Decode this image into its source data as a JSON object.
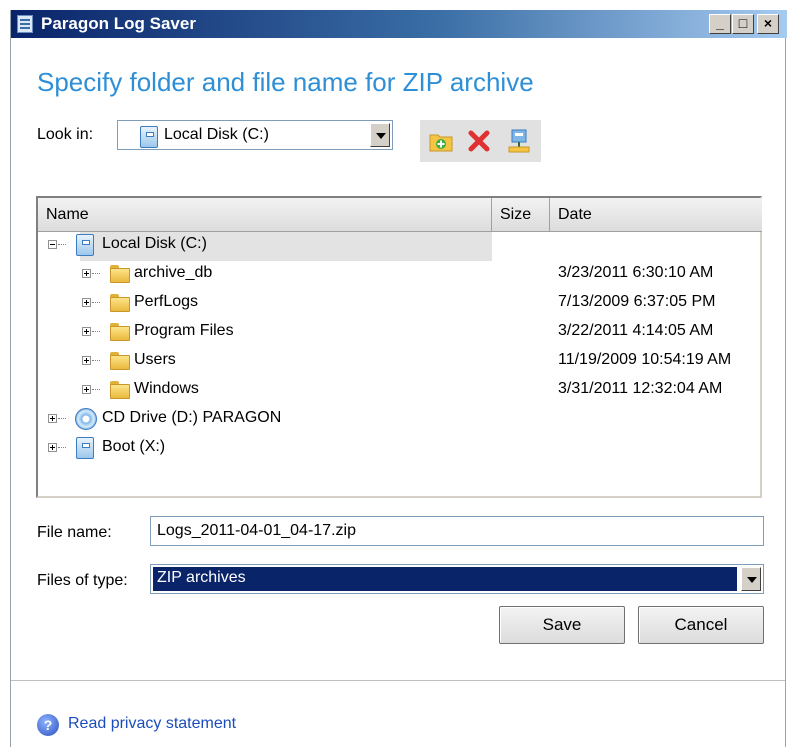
{
  "window": {
    "title": "Paragon Log Saver",
    "controls": {
      "minimize": "_",
      "maximize": "□",
      "close": "×"
    }
  },
  "heading": "Specify folder and file name for ZIP archive",
  "lookin": {
    "label": "Look in:",
    "value": "Local Disk (C:)"
  },
  "toolbar": {
    "icons": [
      "new-folder-icon",
      "delete-icon",
      "network-drive-icon"
    ]
  },
  "filelist": {
    "columns": {
      "name": "Name",
      "size": "Size",
      "date": "Date"
    },
    "rows": [
      {
        "name": "Local Disk (C:)",
        "icon": "disk-icon",
        "size": "",
        "date": ""
      },
      {
        "name": "archive_db",
        "icon": "folder-icon",
        "size": "",
        "date": "3/23/2011 6:30:10 AM"
      },
      {
        "name": "PerfLogs",
        "icon": "folder-icon",
        "size": "",
        "date": "7/13/2009 6:37:05 PM"
      },
      {
        "name": "Program Files",
        "icon": "folder-icon",
        "size": "",
        "date": "3/22/2011 4:14:05 AM"
      },
      {
        "name": "Users",
        "icon": "folder-icon",
        "size": "",
        "date": "11/19/2009 10:54:19 AM"
      },
      {
        "name": "Windows",
        "icon": "folder-icon",
        "size": "",
        "date": "3/31/2011 12:32:04 AM"
      },
      {
        "name": "CD Drive (D:) PARAGON",
        "icon": "cd-drive-icon",
        "size": "",
        "date": ""
      },
      {
        "name": "Boot (X:)",
        "icon": "disk-icon",
        "size": "",
        "date": ""
      }
    ]
  },
  "filename": {
    "label": "File name:",
    "value": "Logs_2011-04-01_04-17.zip"
  },
  "filetype": {
    "label": "Files of type:",
    "value": "ZIP archives"
  },
  "buttons": {
    "save": "Save",
    "cancel": "Cancel"
  },
  "footer": {
    "privacy_link": "Read privacy statement"
  },
  "colors": {
    "heading": "#2e8fd6",
    "selection": "#0a246a",
    "link": "#1a4dbb"
  }
}
